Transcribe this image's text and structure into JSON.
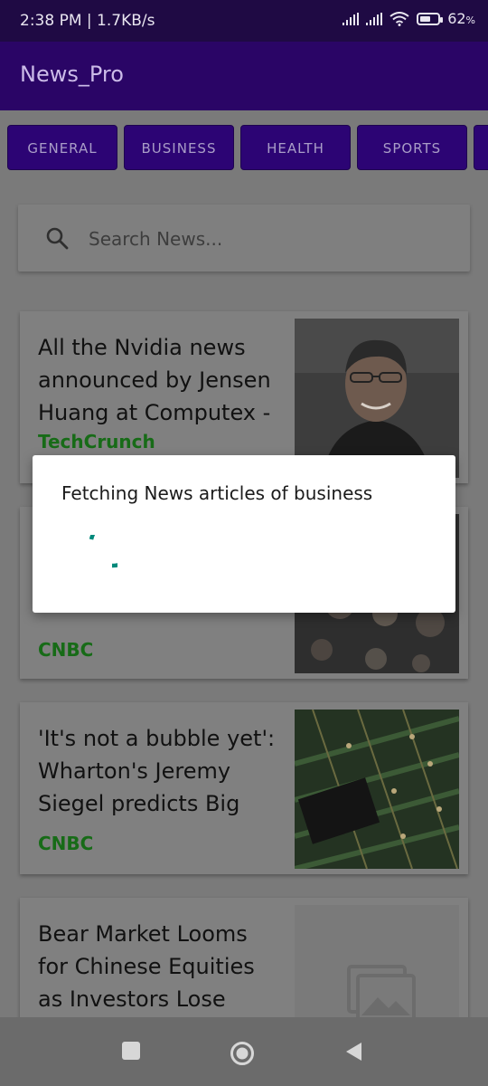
{
  "status": {
    "time_speed": "2:38 PM | 1.7KB/s",
    "battery": "62",
    "battery_pct": 62
  },
  "app": {
    "title": "News_Pro"
  },
  "categories": [
    "GENERAL",
    "BUSINESS",
    "HEALTH",
    "SPORTS"
  ],
  "search": {
    "placeholder": "Search News..."
  },
  "articles": [
    {
      "headline": "All the Nvidia news announced by Jensen Huang at Computex -",
      "source": "TechCrunch"
    },
    {
      "headline": "",
      "source": "CNBC"
    },
    {
      "headline": "'It's not a bubble yet': Wharton's Jeremy Siegel predicts Big",
      "source": "CNBC"
    },
    {
      "headline": "Bear Market Looms for Chinese Equities as Investors Lose",
      "source": ""
    }
  ],
  "dialog": {
    "message": "Fetching News articles of business"
  },
  "colors": {
    "accent": "#2c0474",
    "appbar": "#2a0566",
    "source": "#176b17",
    "spinner": "#00897b"
  }
}
